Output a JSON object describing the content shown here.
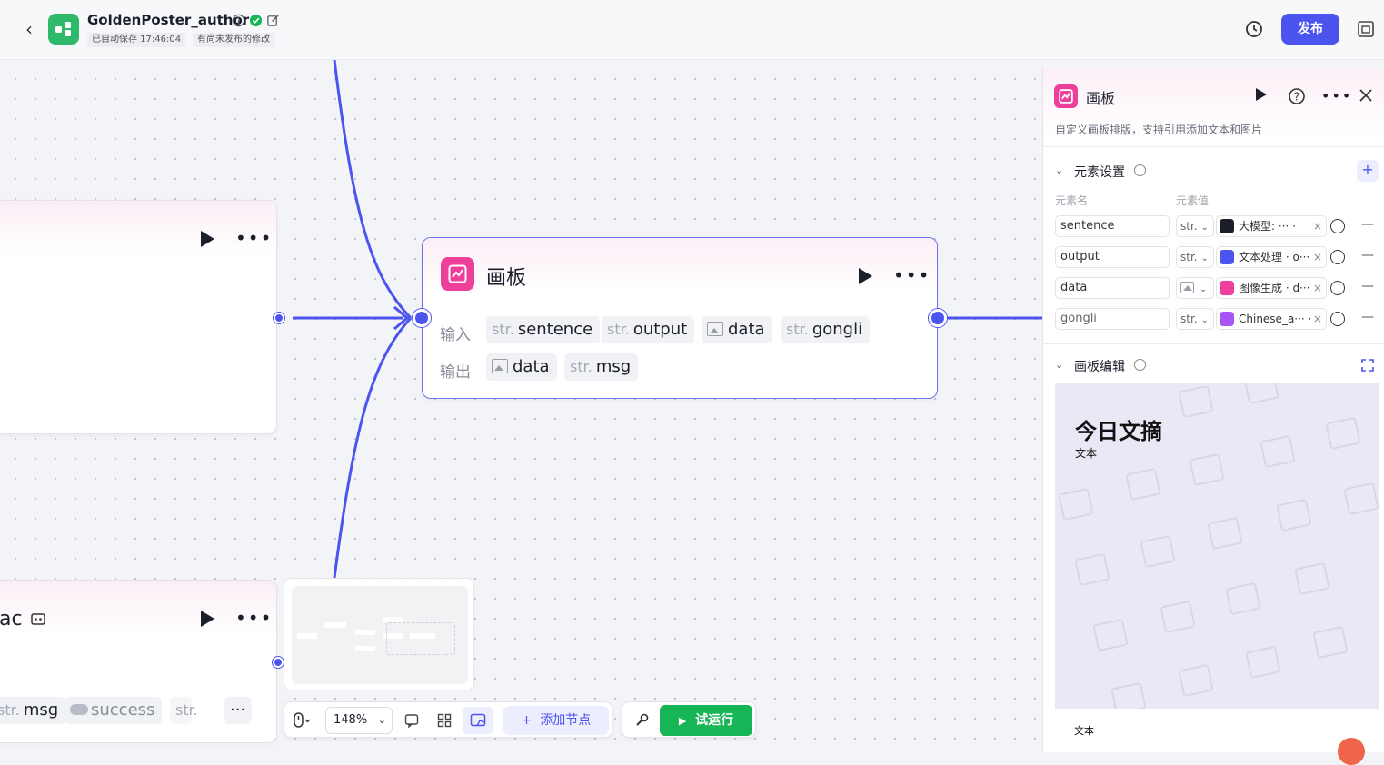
{
  "header": {
    "title": "GoldenPoster_author",
    "autosave": "已自动保存 17:46:04",
    "unpublished": "有尚未发布的修改",
    "publish_label": "发布"
  },
  "colors": {
    "accent": "#4c54f0",
    "run": "#16b556",
    "board_icon": "#ee3f9b",
    "app_logo": "#2fb96b"
  },
  "icons": [
    "back-icon",
    "app-logo-icon",
    "info-icon",
    "verified-icon",
    "edit-icon",
    "history-icon",
    "layout-icon",
    "play-icon",
    "more-icon",
    "help-icon",
    "close-icon",
    "image-icon",
    "clock-icon",
    "fullscreen-icon",
    "wrench-icon",
    "comment-icon",
    "grid-icon",
    "mouse-icon"
  ],
  "main_node": {
    "title": "画板",
    "input_label": "输入",
    "output_label": "输出",
    "inputs": [
      {
        "type": "str.",
        "name": "sentence"
      },
      {
        "type": "image",
        "name": "data"
      },
      {
        "type": "str.",
        "name": "output"
      },
      {
        "type": "str.",
        "name": "gongli"
      }
    ],
    "outputs": [
      {
        "type": "image",
        "name": "data"
      },
      {
        "type": "str.",
        "name": "msg"
      }
    ]
  },
  "bottom_node": {
    "title_fragment": "ac",
    "outputs": [
      {
        "type": "str.",
        "name": "msg"
      },
      {
        "type": "bool",
        "name": "success"
      },
      {
        "type": "str.",
        "name": ""
      }
    ]
  },
  "toolbar": {
    "zoom": "148%",
    "add_node_label": "添加节点",
    "run_label": "试运行"
  },
  "panel": {
    "title": "画板",
    "description": "自定义画板排版，支持引用添加文本和图片",
    "elements_section": "元素设置",
    "col_name": "元素名",
    "col_value": "元素值",
    "elements": [
      {
        "name": "sentence",
        "type": "str.",
        "value": "大模型:  ···  ·",
        "icon_color": "#1d1e2c"
      },
      {
        "name": "output",
        "type": "str.",
        "value": "文本处理 · o···",
        "icon_color": "#4c54f0"
      },
      {
        "name": "data",
        "type": "image",
        "value": "图像生成 · d···",
        "icon_color": "#ee3f9b"
      },
      {
        "name": "gongli",
        "type": "str.",
        "value": "Chinese_a··· ·",
        "icon_color": "#a855f7"
      }
    ],
    "editor_section": "画板编辑",
    "board_title": "今日文摘",
    "board_subtitle": "文本",
    "board_footer": "文本"
  }
}
